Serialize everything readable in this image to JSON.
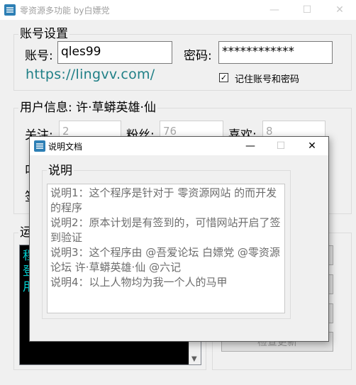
{
  "window": {
    "title": "零资源多功能 by白嫖党",
    "minimize_glyph": "—",
    "maximize_glyph": "☐",
    "close_glyph": "✕",
    "icon": "app-logo-icon"
  },
  "account": {
    "group_title": "账号设置",
    "username_label": "账号:",
    "username_value": "qles99",
    "password_label": "密码:",
    "password_value": "************",
    "site_link": "https://lingvv.com/",
    "remember_checked": true,
    "remember_label": "记住账号和密码"
  },
  "user_info": {
    "group_title": "用户信息: 许·草蟒英雄·仙",
    "follow_label": "关注:",
    "follow_value": "2",
    "fans_label": "粉丝:",
    "fans_value": "76",
    "likes_label": "喜欢:",
    "likes_value": "8",
    "hidden_label_1": "叫",
    "hidden_label_2": "签"
  },
  "run": {
    "group_title": "运",
    "log_lines": [
      "程",
      "登",
      "用"
    ],
    "check_update_label": "检查更新"
  },
  "dialog": {
    "title": "说明文档",
    "icon": "document-icon",
    "minimize_glyph": "—",
    "maximize_glyph": "☐",
    "close_glyph": "✕",
    "group_title": "说明",
    "lines": [
      "说明1：这个程序是针对于 零资源网站 的而开发的程序",
      "说明2：原本计划是有签到的，可惜网站开启了签到验证",
      "说明3：这个程序由  @吾爱论坛 白嫖党 @零资源论坛 许·草蟒英雄·仙 @六记",
      "说明4：以上人物均为我一个人的马甲"
    ]
  },
  "colors": {
    "link": "#1f7f86",
    "log_background": "#000000",
    "log_text": "#00d7d7",
    "icon_blue": "#2d7fb5"
  }
}
